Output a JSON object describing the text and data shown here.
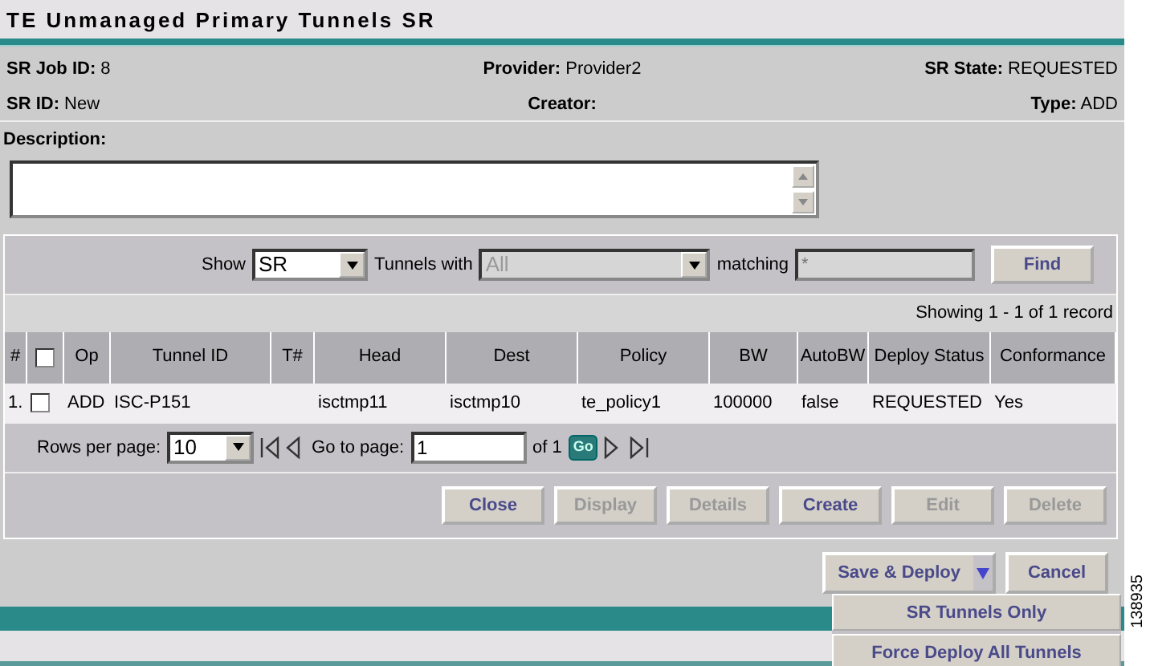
{
  "title": "TE Unmanaged Primary Tunnels SR",
  "info": [
    {
      "label": "SR Job ID:",
      "value": "8"
    },
    {
      "label": "Provider:",
      "value": "Provider2"
    },
    {
      "label": "SR State:",
      "value": "REQUESTED"
    },
    {
      "label": "SR ID:",
      "value": "New"
    },
    {
      "label": "Creator:"
    },
    {
      "label": "Type:",
      "value": "ADD"
    }
  ],
  "description": {
    "label": "Description:"
  },
  "filter": {
    "show_label": "Show",
    "show_value": "SR",
    "tunnels_label": "Tunnels with",
    "tunnels_value": "All",
    "tunnels_disabled": true,
    "matching_label": "matching",
    "matching_placeholder": "*",
    "find": "Find"
  },
  "showing": "Showing 1 - 1 of 1 record",
  "table": {
    "columns": [
      "#",
      "",
      "Op",
      "Tunnel ID",
      "T#",
      "Head",
      "Dest",
      "Policy",
      "BW",
      "AutoBW",
      "Deploy Status",
      "Conformance"
    ],
    "select_all_checked": false,
    "rows": [
      {
        "checked": false,
        "cells": [
          "1.",
          "",
          "ADD",
          "ISC-P151",
          "",
          "isctmp11",
          "isctmp10",
          "te_policy1",
          "100000",
          "false",
          "REQUESTED",
          "Yes"
        ]
      }
    ]
  },
  "pager": {
    "rows_label": "Rows per page:",
    "rows_value": "10",
    "goto_label": "Go to page:",
    "page": "1",
    "of": "of 1",
    "go": "Go"
  },
  "actions": [
    {
      "label": "Close",
      "disabled": false
    },
    {
      "label": "Display",
      "disabled": true
    },
    {
      "label": "Details",
      "disabled": true
    },
    {
      "label": "Create",
      "disabled": false
    },
    {
      "label": "Edit",
      "disabled": true
    },
    {
      "label": "Delete",
      "disabled": true
    }
  ],
  "save_deploy": {
    "label": "Save & Deploy",
    "expanded": true,
    "menu": [
      "SR Tunnels Only",
      "Force Deploy All Tunnels"
    ]
  },
  "cancel": "Cancel",
  "figure_id": "138935"
}
